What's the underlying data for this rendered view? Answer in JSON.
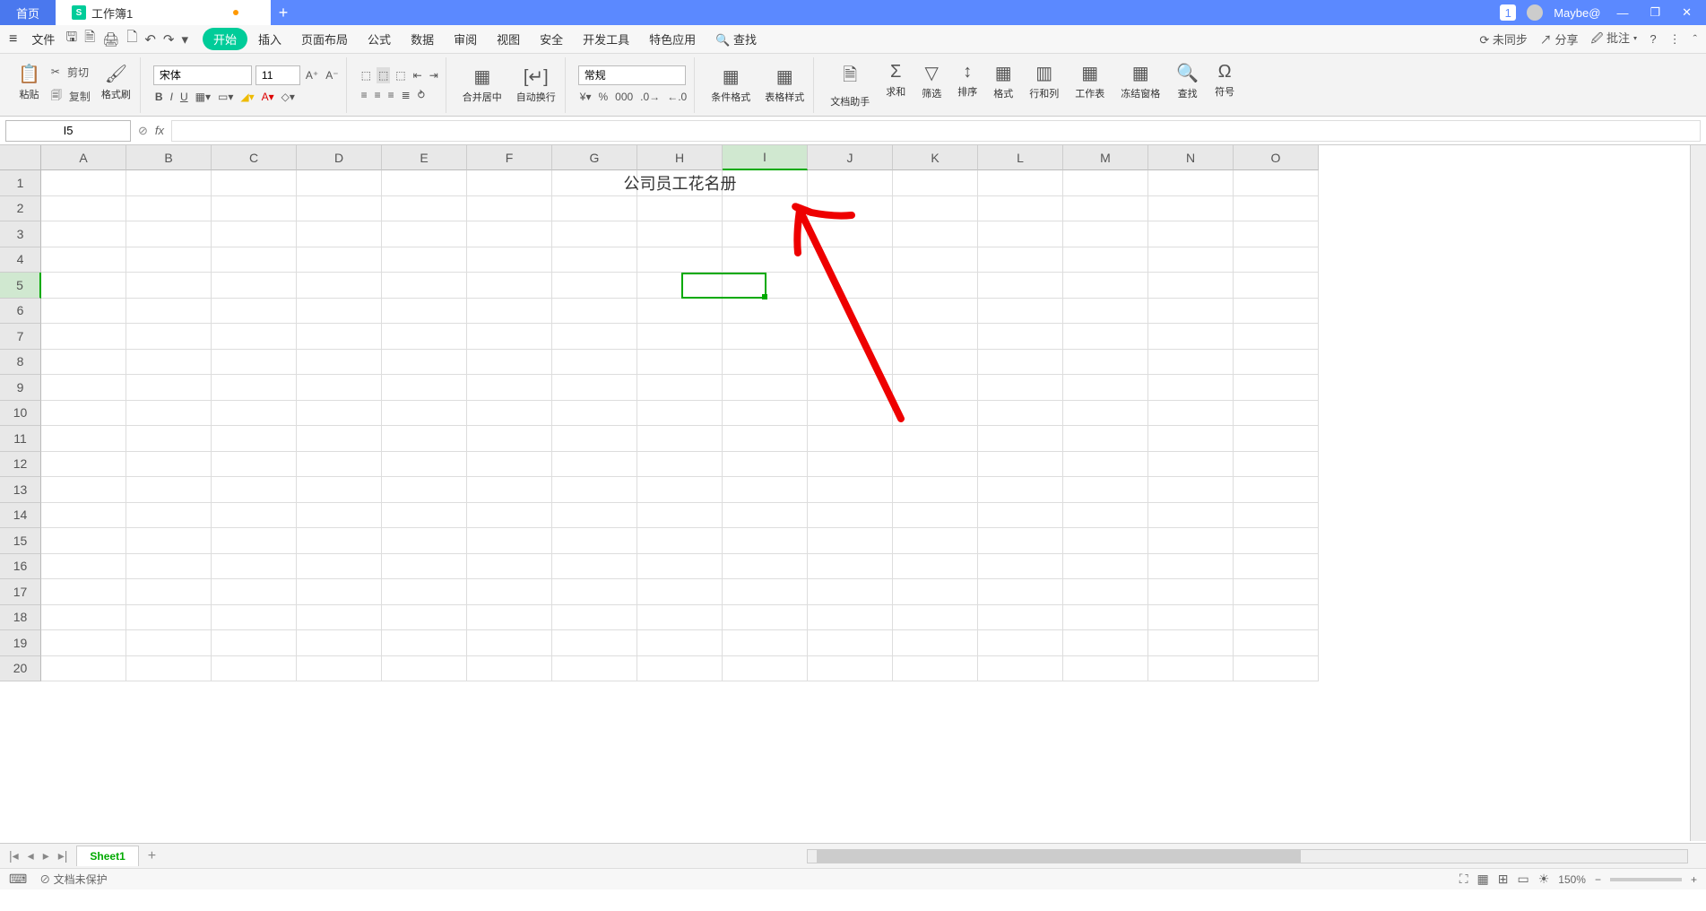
{
  "titlebar": {
    "home_tab": "首页",
    "doc_tab": "工作簿1",
    "add": "+",
    "badge": "1",
    "user": "Maybe@",
    "min": "—",
    "max": "❐",
    "close": "✕"
  },
  "menubar": {
    "file": "文件",
    "items": [
      "开始",
      "插入",
      "页面布局",
      "公式",
      "数据",
      "审阅",
      "视图",
      "安全",
      "开发工具",
      "特色应用"
    ],
    "active": "开始",
    "search": "查找",
    "right": {
      "sync": "未同步",
      "share": "分享",
      "批注": "批注"
    }
  },
  "ribbon": {
    "paste": "粘贴",
    "cut": "剪切",
    "copy": "复制",
    "fmtpaint": "格式刷",
    "font_name": "宋体",
    "font_size": "11",
    "merge": "合并居中",
    "wrap": "自动换行",
    "numfmt": "常规",
    "condfmt": "条件格式",
    "tblstyle": "表格样式",
    "dochelp": "文档助手",
    "sum": "求和",
    "filter": "筛选",
    "sort": "排序",
    "format": "格式",
    "rowcol": "行和列",
    "worksheet": "工作表",
    "freeze": "冻结窗格",
    "find": "查找",
    "symbol": "符号"
  },
  "fbar": {
    "cell": "I5",
    "fx": "fx"
  },
  "grid": {
    "cols": [
      "A",
      "B",
      "C",
      "D",
      "E",
      "F",
      "G",
      "H",
      "I",
      "J",
      "K",
      "L",
      "M",
      "N",
      "O"
    ],
    "rows": [
      "1",
      "2",
      "3",
      "4",
      "5",
      "6",
      "7",
      "8",
      "9",
      "10",
      "11",
      "12",
      "13",
      "14",
      "15",
      "16",
      "17",
      "18",
      "19",
      "20"
    ],
    "title": "公司员工花名册",
    "active_col": 8,
    "active_row": 4
  },
  "sheetbar": {
    "sheet": "Sheet1",
    "add": "+"
  },
  "statusbar": {
    "protect": "文档未保护",
    "zoom": "150%"
  }
}
